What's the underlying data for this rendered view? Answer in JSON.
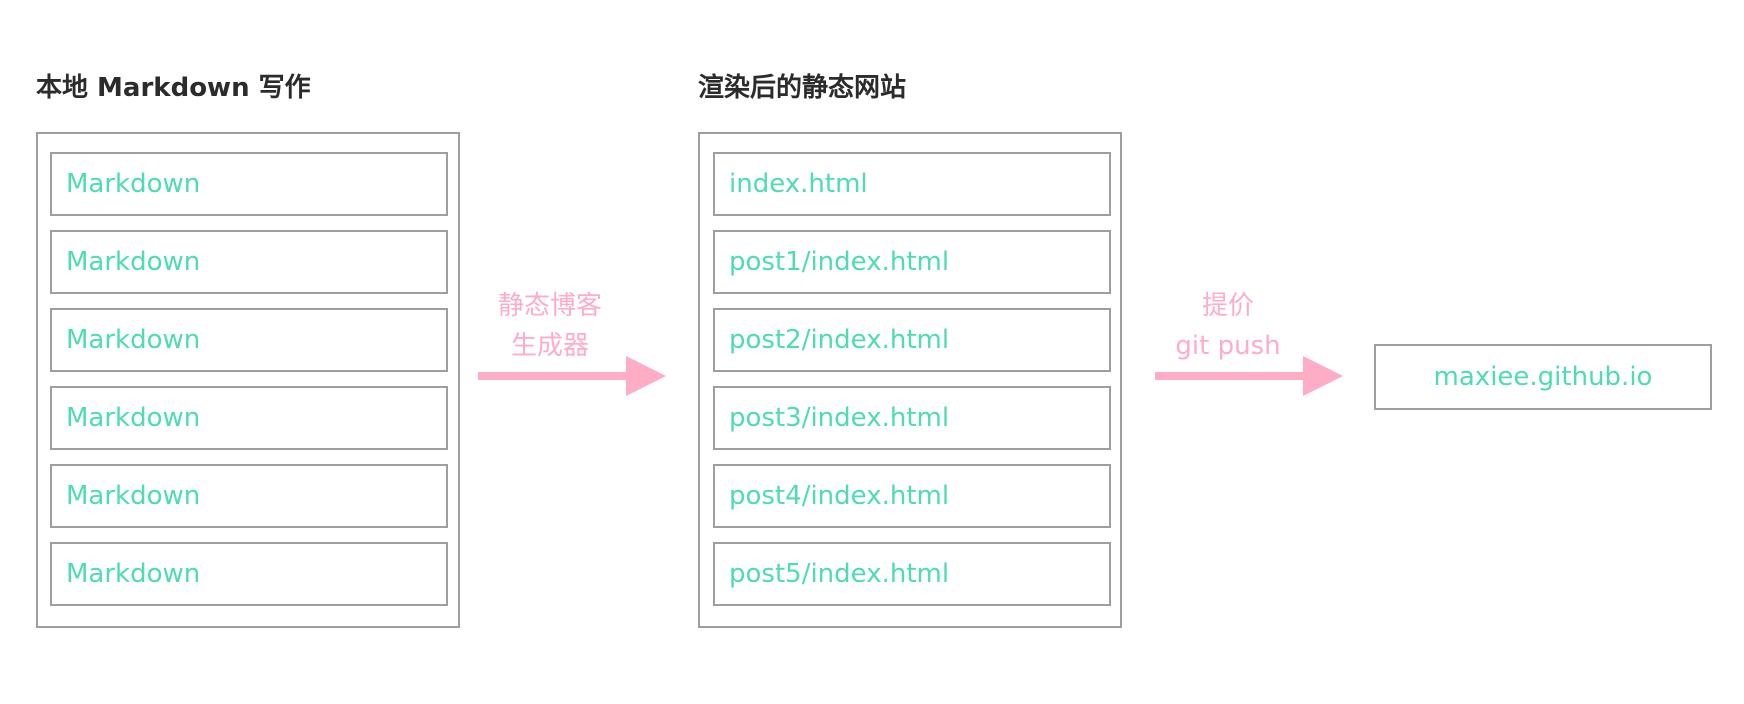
{
  "left_section": {
    "title": "本地 Markdown 写作",
    "items": [
      "Markdown",
      "Markdown",
      "Markdown",
      "Markdown",
      "Markdown",
      "Markdown"
    ]
  },
  "arrow_1": {
    "label_line1": "静态博客",
    "label_line2": "生成器"
  },
  "middle_section": {
    "title": "渲染后的静态网站",
    "items": [
      "index.html",
      "post1/index.html",
      "post2/index.html",
      "post3/index.html",
      "post4/index.html",
      "post5/index.html"
    ]
  },
  "arrow_2": {
    "label_line1": "提价",
    "label_line2": "git push"
  },
  "target": {
    "label": "maxiee.github.io"
  },
  "colors": {
    "node_text": "#4ddcb4",
    "arrow": "#ffadc6",
    "border": "#9e9e9e",
    "title_text": "#2b2b2b"
  }
}
